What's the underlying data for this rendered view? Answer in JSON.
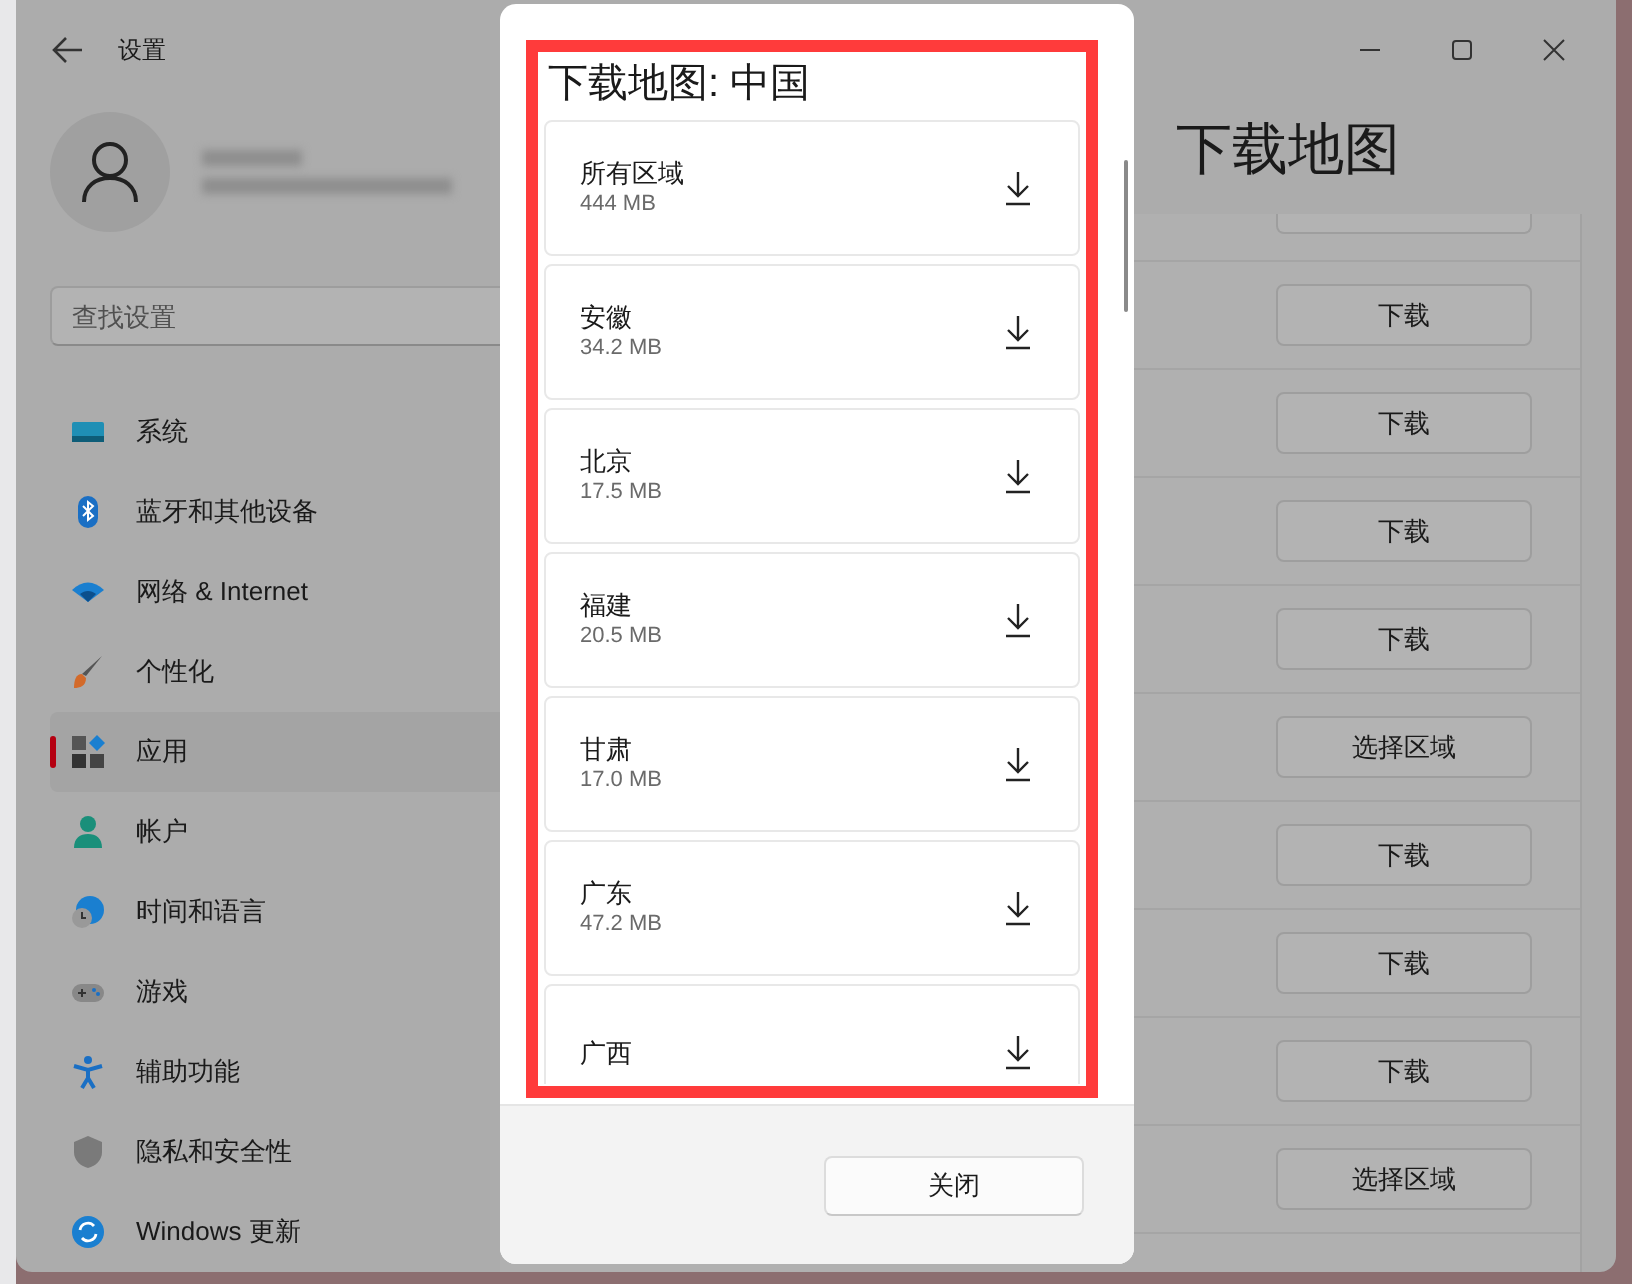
{
  "window": {
    "title": "设置"
  },
  "account": {
    "name_redacted": true
  },
  "search": {
    "placeholder": "查找设置"
  },
  "nav": [
    {
      "label": "系统",
      "selected": false
    },
    {
      "label": "蓝牙和其他设备",
      "selected": false
    },
    {
      "label": "网络 & Internet",
      "selected": false
    },
    {
      "label": "个性化",
      "selected": false
    },
    {
      "label": "应用",
      "selected": true
    },
    {
      "label": "帐户",
      "selected": false
    },
    {
      "label": "时间和语言",
      "selected": false
    },
    {
      "label": "游戏",
      "selected": false
    },
    {
      "label": "辅助功能",
      "selected": false
    },
    {
      "label": "隐私和安全性",
      "selected": false
    },
    {
      "label": "Windows 更新",
      "selected": false
    }
  ],
  "page": {
    "title": "下载地图",
    "rows": [
      {
        "kind": "cut"
      },
      {
        "kind": "button",
        "button": "下载"
      },
      {
        "kind": "button",
        "button": "下载"
      },
      {
        "kind": "button",
        "button": "下载"
      },
      {
        "kind": "button",
        "button": "下载"
      },
      {
        "kind": "button",
        "button": "选择区域"
      },
      {
        "kind": "button",
        "button": "下载"
      },
      {
        "kind": "button",
        "button": "下载"
      },
      {
        "kind": "button",
        "button": "下载"
      },
      {
        "kind": "button",
        "button": "选择区域"
      }
    ]
  },
  "dialog": {
    "title": "下载地图: 中国",
    "regions": [
      {
        "name": "所有区域",
        "size": "444 MB"
      },
      {
        "name": "安徽",
        "size": "34.2 MB"
      },
      {
        "name": "北京",
        "size": "17.5 MB"
      },
      {
        "name": "福建",
        "size": "20.5 MB"
      },
      {
        "name": "甘肃",
        "size": "17.0 MB"
      },
      {
        "name": "广东",
        "size": "47.2 MB"
      },
      {
        "name": "广西"
      }
    ],
    "close_button": "关闭"
  },
  "annotation": {
    "kind": "frame"
  }
}
